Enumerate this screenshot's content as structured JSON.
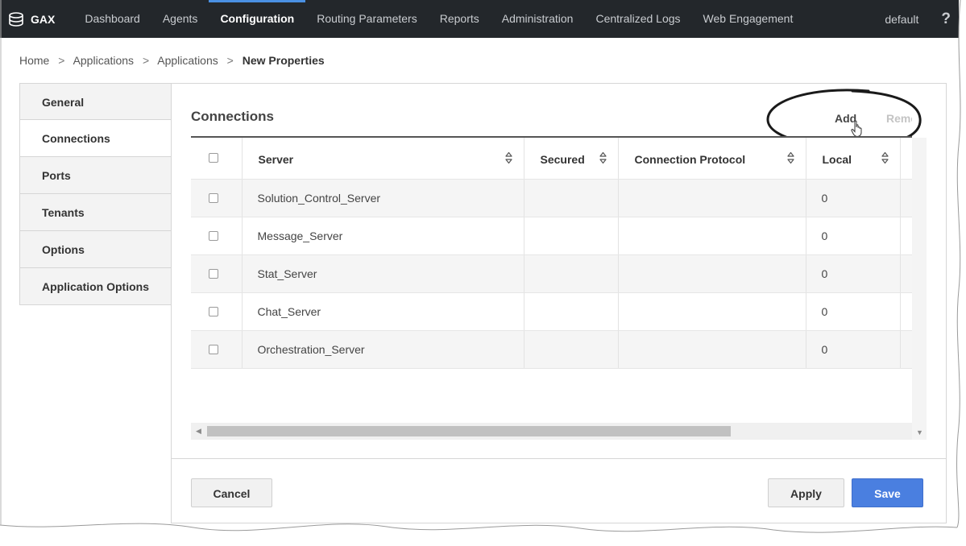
{
  "brand": {
    "name": "GAX",
    "icon": "database-icon"
  },
  "nav": {
    "items": [
      {
        "label": "Dashboard",
        "active": false
      },
      {
        "label": "Agents",
        "active": false
      },
      {
        "label": "Configuration",
        "active": true
      },
      {
        "label": "Routing Parameters",
        "active": false
      },
      {
        "label": "Reports",
        "active": false
      },
      {
        "label": "Administration",
        "active": false
      },
      {
        "label": "Centralized Logs",
        "active": false
      },
      {
        "label": "Web Engagement",
        "active": false
      }
    ],
    "user": "default",
    "help": "?"
  },
  "breadcrumb": {
    "items": [
      "Home",
      "Applications",
      "Applications"
    ],
    "current": "New Properties",
    "separator": ">"
  },
  "sidebar": {
    "tabs": [
      {
        "label": "General",
        "active": false
      },
      {
        "label": "Connections",
        "active": true
      },
      {
        "label": "Ports",
        "active": false
      },
      {
        "label": "Tenants",
        "active": false
      },
      {
        "label": "Options",
        "active": false
      },
      {
        "label": "Application Options",
        "active": false
      }
    ]
  },
  "connections": {
    "title": "Connections",
    "add_label": "Add",
    "remove_label": "Remove",
    "columns": [
      "Server",
      "Secured",
      "Connection Protocol",
      "Local"
    ],
    "rows": [
      {
        "server": "Solution_Control_Server",
        "secured": "",
        "protocol": "",
        "local": "0"
      },
      {
        "server": "Message_Server",
        "secured": "",
        "protocol": "",
        "local": "0"
      },
      {
        "server": "Stat_Server",
        "secured": "",
        "protocol": "",
        "local": "0"
      },
      {
        "server": "Chat_Server",
        "secured": "",
        "protocol": "",
        "local": "0"
      },
      {
        "server": "Orchestration_Server",
        "secured": "",
        "protocol": "",
        "local": "0"
      }
    ]
  },
  "footer": {
    "cancel_label": "Cancel",
    "apply_label": "Apply",
    "save_label": "Save"
  },
  "colors": {
    "navbar": "#23272b",
    "accent": "#4a90e2",
    "save_button": "#4a7fe0"
  }
}
